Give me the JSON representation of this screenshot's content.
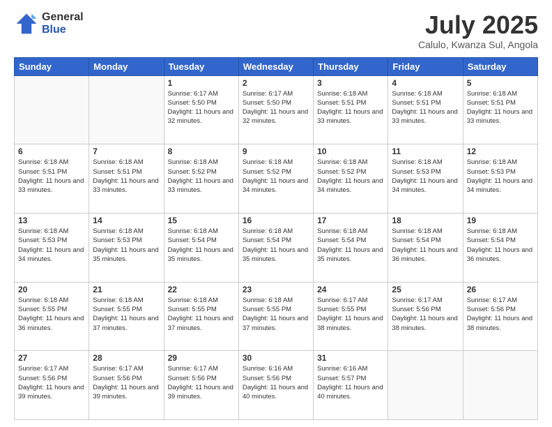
{
  "header": {
    "logo_general": "General",
    "logo_blue": "Blue",
    "title": "July 2025",
    "location": "Calulo, Kwanza Sul, Angola"
  },
  "days_of_week": [
    "Sunday",
    "Monday",
    "Tuesday",
    "Wednesday",
    "Thursday",
    "Friday",
    "Saturday"
  ],
  "weeks": [
    [
      {
        "day": "",
        "info": ""
      },
      {
        "day": "",
        "info": ""
      },
      {
        "day": "1",
        "info": "Sunrise: 6:17 AM\nSunset: 5:50 PM\nDaylight: 11 hours and 32 minutes."
      },
      {
        "day": "2",
        "info": "Sunrise: 6:17 AM\nSunset: 5:50 PM\nDaylight: 11 hours and 32 minutes."
      },
      {
        "day": "3",
        "info": "Sunrise: 6:18 AM\nSunset: 5:51 PM\nDaylight: 11 hours and 33 minutes."
      },
      {
        "day": "4",
        "info": "Sunrise: 6:18 AM\nSunset: 5:51 PM\nDaylight: 11 hours and 33 minutes."
      },
      {
        "day": "5",
        "info": "Sunrise: 6:18 AM\nSunset: 5:51 PM\nDaylight: 11 hours and 33 minutes."
      }
    ],
    [
      {
        "day": "6",
        "info": "Sunrise: 6:18 AM\nSunset: 5:51 PM\nDaylight: 11 hours and 33 minutes."
      },
      {
        "day": "7",
        "info": "Sunrise: 6:18 AM\nSunset: 5:51 PM\nDaylight: 11 hours and 33 minutes."
      },
      {
        "day": "8",
        "info": "Sunrise: 6:18 AM\nSunset: 5:52 PM\nDaylight: 11 hours and 33 minutes."
      },
      {
        "day": "9",
        "info": "Sunrise: 6:18 AM\nSunset: 5:52 PM\nDaylight: 11 hours and 34 minutes."
      },
      {
        "day": "10",
        "info": "Sunrise: 6:18 AM\nSunset: 5:52 PM\nDaylight: 11 hours and 34 minutes."
      },
      {
        "day": "11",
        "info": "Sunrise: 6:18 AM\nSunset: 5:53 PM\nDaylight: 11 hours and 34 minutes."
      },
      {
        "day": "12",
        "info": "Sunrise: 6:18 AM\nSunset: 5:53 PM\nDaylight: 11 hours and 34 minutes."
      }
    ],
    [
      {
        "day": "13",
        "info": "Sunrise: 6:18 AM\nSunset: 5:53 PM\nDaylight: 11 hours and 34 minutes."
      },
      {
        "day": "14",
        "info": "Sunrise: 6:18 AM\nSunset: 5:53 PM\nDaylight: 11 hours and 35 minutes."
      },
      {
        "day": "15",
        "info": "Sunrise: 6:18 AM\nSunset: 5:54 PM\nDaylight: 11 hours and 35 minutes."
      },
      {
        "day": "16",
        "info": "Sunrise: 6:18 AM\nSunset: 5:54 PM\nDaylight: 11 hours and 35 minutes."
      },
      {
        "day": "17",
        "info": "Sunrise: 6:18 AM\nSunset: 5:54 PM\nDaylight: 11 hours and 35 minutes."
      },
      {
        "day": "18",
        "info": "Sunrise: 6:18 AM\nSunset: 5:54 PM\nDaylight: 11 hours and 36 minutes."
      },
      {
        "day": "19",
        "info": "Sunrise: 6:18 AM\nSunset: 5:54 PM\nDaylight: 11 hours and 36 minutes."
      }
    ],
    [
      {
        "day": "20",
        "info": "Sunrise: 6:18 AM\nSunset: 5:55 PM\nDaylight: 11 hours and 36 minutes."
      },
      {
        "day": "21",
        "info": "Sunrise: 6:18 AM\nSunset: 5:55 PM\nDaylight: 11 hours and 37 minutes."
      },
      {
        "day": "22",
        "info": "Sunrise: 6:18 AM\nSunset: 5:55 PM\nDaylight: 11 hours and 37 minutes."
      },
      {
        "day": "23",
        "info": "Sunrise: 6:18 AM\nSunset: 5:55 PM\nDaylight: 11 hours and 37 minutes."
      },
      {
        "day": "24",
        "info": "Sunrise: 6:17 AM\nSunset: 5:55 PM\nDaylight: 11 hours and 38 minutes."
      },
      {
        "day": "25",
        "info": "Sunrise: 6:17 AM\nSunset: 5:56 PM\nDaylight: 11 hours and 38 minutes."
      },
      {
        "day": "26",
        "info": "Sunrise: 6:17 AM\nSunset: 5:56 PM\nDaylight: 11 hours and 38 minutes."
      }
    ],
    [
      {
        "day": "27",
        "info": "Sunrise: 6:17 AM\nSunset: 5:56 PM\nDaylight: 11 hours and 39 minutes."
      },
      {
        "day": "28",
        "info": "Sunrise: 6:17 AM\nSunset: 5:56 PM\nDaylight: 11 hours and 39 minutes."
      },
      {
        "day": "29",
        "info": "Sunrise: 6:17 AM\nSunset: 5:56 PM\nDaylight: 11 hours and 39 minutes."
      },
      {
        "day": "30",
        "info": "Sunrise: 6:16 AM\nSunset: 5:56 PM\nDaylight: 11 hours and 40 minutes."
      },
      {
        "day": "31",
        "info": "Sunrise: 6:16 AM\nSunset: 5:57 PM\nDaylight: 11 hours and 40 minutes."
      },
      {
        "day": "",
        "info": ""
      },
      {
        "day": "",
        "info": ""
      }
    ]
  ]
}
